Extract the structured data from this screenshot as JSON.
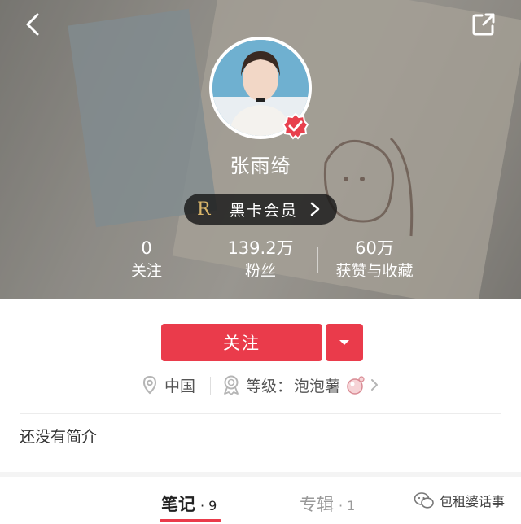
{
  "profile": {
    "name": "张雨绮",
    "vip_mark": "R",
    "vip_label": "黑卡会员"
  },
  "stats": [
    {
      "value": "0",
      "label": "关注"
    },
    {
      "value": "139.2万",
      "label": "粉丝"
    },
    {
      "value": "60万",
      "label": "获赞与收藏"
    }
  ],
  "actions": {
    "follow_label": "关注"
  },
  "meta": {
    "location": "中国",
    "level_label": "等级：",
    "level_value": "泡泡薯"
  },
  "bio": "还没有简介",
  "tabs": [
    {
      "label": "笔记",
      "count": "· 9"
    },
    {
      "label": "专辑",
      "count": "· 1"
    }
  ],
  "watermark": "包租婆话事",
  "colors": {
    "accent": "#ea3b4b",
    "vip_gold": "#d9b56a",
    "verified": "#e8404d"
  },
  "icons": [
    "back-icon",
    "share-icon",
    "verified-icon",
    "chevron-right-icon",
    "dropdown-caret-icon",
    "location-pin-icon",
    "level-badge-icon",
    "level-bubble-icon",
    "wechat-icon"
  ]
}
